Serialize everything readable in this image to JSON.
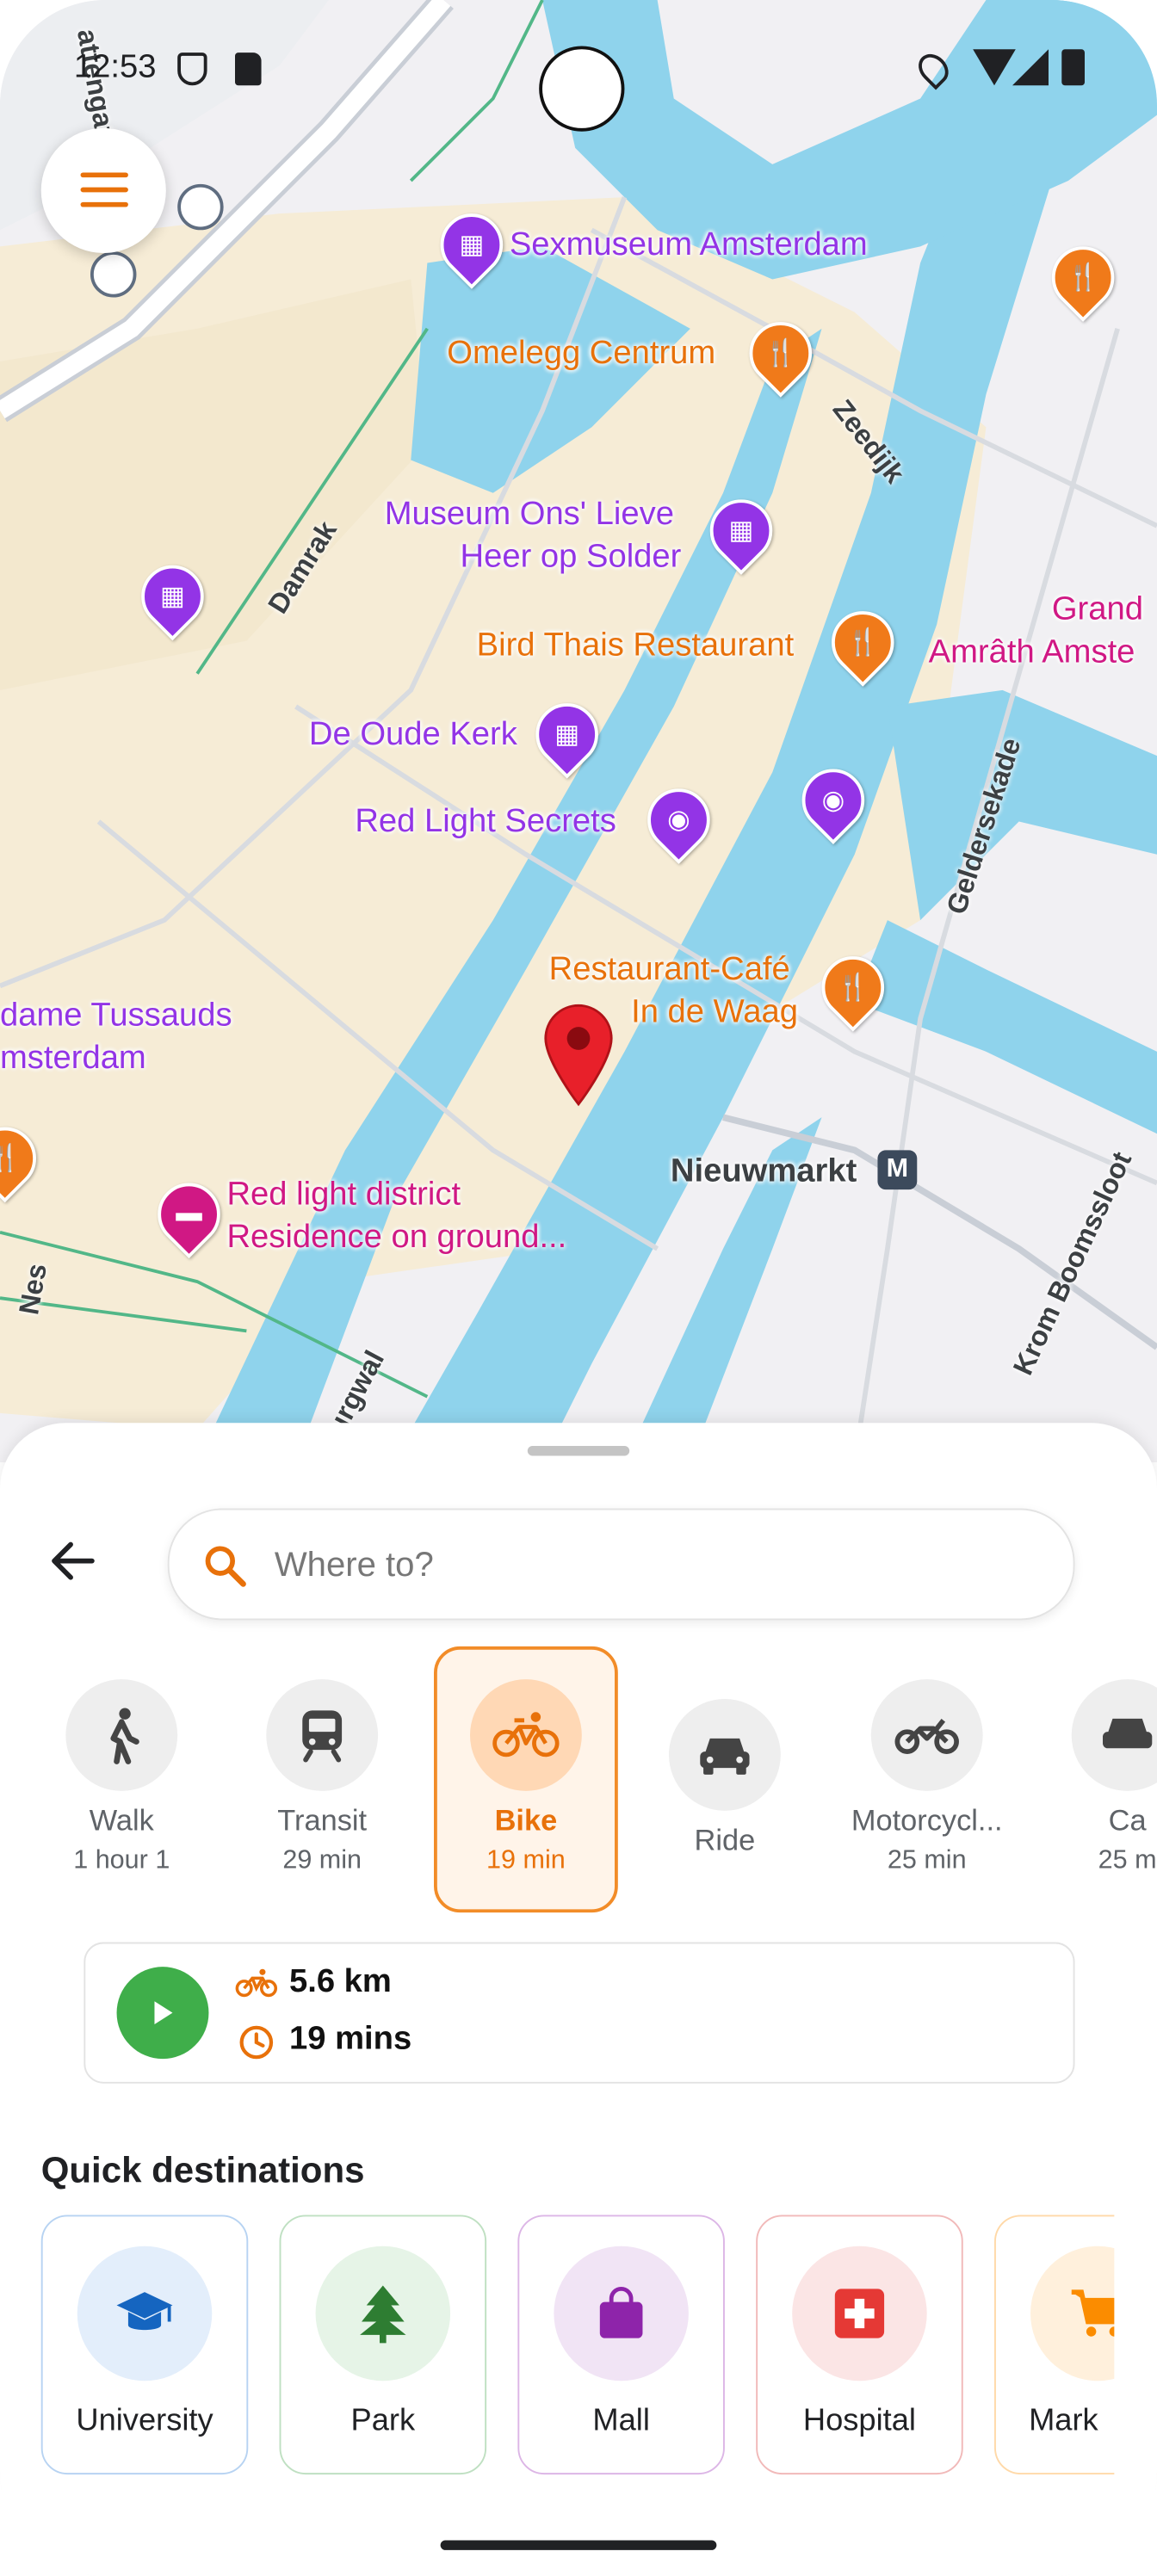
{
  "status_bar": {
    "time": "12:53"
  },
  "map": {
    "pois": [
      {
        "name": "Sexmuseum Amsterdam",
        "type": "museum"
      },
      {
        "name": "Omelegg Centrum",
        "type": "restaurant"
      },
      {
        "name_line1": "Museum Ons' Lieve",
        "name_line2": "Heer op Solder",
        "type": "museum"
      },
      {
        "name": "Bird Thais Restaurant",
        "type": "restaurant"
      },
      {
        "name": "De Oude Kerk",
        "type": "museum"
      },
      {
        "name": "Red Light Secrets",
        "type": "attraction"
      },
      {
        "name_line1": "Restaurant-Café",
        "name_line2": "In de Waag",
        "type": "restaurant"
      },
      {
        "name_line1": "dame Tussauds",
        "name_line2": "msterdam",
        "type": "attraction"
      },
      {
        "name_line1": "Red light district",
        "name_line2": "Residence on ground...",
        "type": "hotel"
      },
      {
        "name": "Nieuwmarkt",
        "type": "metro"
      },
      {
        "name_line1": "Grand",
        "name_line2": "Amrâth Amste",
        "type": "hotel"
      }
    ],
    "streets": [
      "Damrak",
      "Zeedijk",
      "Geldersekade",
      "Krom Boomssloot",
      "urgwal",
      "Nes",
      "attengat"
    ],
    "metro_badge": "M",
    "menu_icon": "hamburger-icon",
    "selected_marker": "red-location-pin"
  },
  "search": {
    "placeholder": "Where to?"
  },
  "travel_modes": [
    {
      "label": "Walk",
      "time": "1 hour 1",
      "icon": "walk-icon"
    },
    {
      "label": "Transit",
      "time": "29 min",
      "icon": "train-icon"
    },
    {
      "label": "Bike",
      "time": "19 min",
      "icon": "bike-icon",
      "selected": true
    },
    {
      "label": "Ride",
      "time": "",
      "icon": "car-icon"
    },
    {
      "label": "Motorcycl...",
      "time": "25 min",
      "icon": "motorcycle-icon"
    },
    {
      "label": "Ca",
      "time": "25 m",
      "icon": "car-icon"
    }
  ],
  "route": {
    "distance": "5.6 km",
    "duration": "19 mins"
  },
  "quick_destinations": {
    "title": "Quick destinations",
    "items": [
      {
        "label": "University",
        "icon": "graduation-cap-icon",
        "color": "#1565c0"
      },
      {
        "label": "Park",
        "icon": "tree-icon",
        "color": "#2e7d32"
      },
      {
        "label": "Mall",
        "icon": "shopping-bag-icon",
        "color": "#8e24aa"
      },
      {
        "label": "Hospital",
        "icon": "hospital-icon",
        "color": "#e53935"
      },
      {
        "label": "Mark",
        "icon": "cart-icon",
        "color": "#fb8c00"
      }
    ]
  },
  "colors": {
    "accent": "#e8710a",
    "go": "#3fae4a"
  }
}
